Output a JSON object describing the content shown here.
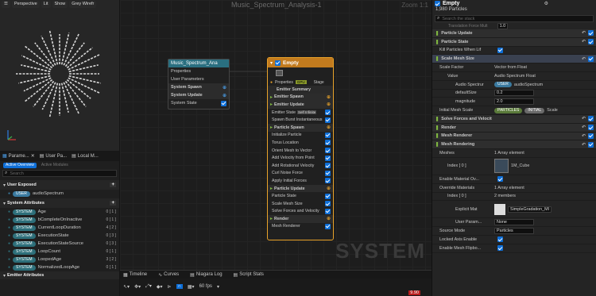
{
  "viewport": {
    "buttons": [
      "Perspective",
      "Lit",
      "Show",
      "Grey Wirefr"
    ]
  },
  "left_tabs": [
    "Parame...",
    "User Pa...",
    "Local M..."
  ],
  "left_subtabs": [
    "Active Overview",
    "Active Modules"
  ],
  "left_search_placeholder": "Search",
  "user_exposed": {
    "title": "User Exposed",
    "items": [
      {
        "tag": "USER",
        "name": "audioSpectrum",
        "count": ""
      }
    ]
  },
  "system_attributes": {
    "title": "System Attributes",
    "items": [
      {
        "tag": "SYSTEM",
        "name": "Age",
        "count": "0 [ 1 ]"
      },
      {
        "tag": "SYSTEM",
        "name": "bCompleteOnInactive",
        "count": "0 [ 1 ]"
      },
      {
        "tag": "SYSTEM",
        "name": "CurrentLoopDuration",
        "count": "4 [ 2 ]"
      },
      {
        "tag": "SYSTEM",
        "name": "ExecutionState",
        "count": "0 [ 3 ]"
      },
      {
        "tag": "SYSTEM",
        "name": "ExecutionStateSource",
        "count": "0 [ 3 ]"
      },
      {
        "tag": "SYSTEM",
        "name": "LoopCount",
        "count": "0 [ 1 ]"
      },
      {
        "tag": "SYSTEM",
        "name": "LoopedAge",
        "count": "3 [ 2 ]"
      },
      {
        "tag": "SYSTEM",
        "name": "NormalizedLoopAge",
        "count": "0 [ 1 ]"
      }
    ]
  },
  "emitter_attributes_title": "Emitter Attributes",
  "graph": {
    "title": "Music_Spectrum_Analysis-1",
    "zoom": "Zoom 1:1",
    "watermark": "SYSTEM",
    "system_node": {
      "title": "Music_Spectrum_Ana",
      "rows": [
        "Properties",
        "User Parameters",
        "System Spawn",
        "System Update",
        "System State"
      ]
    },
    "emitter_node": {
      "title": "Empty",
      "props": [
        "Properties",
        "GPU",
        "Stage"
      ],
      "rows": [
        {
          "label": "Emitter Summary",
          "kind": "header"
        },
        {
          "label": "Emitter Spawn",
          "kind": "section"
        },
        {
          "label": "Emitter Update",
          "kind": "section"
        },
        {
          "label": "Emitter State",
          "kind": "item",
          "extra": "Self  Infinite"
        },
        {
          "label": "Spawn Burst Instantaneous",
          "kind": "item"
        },
        {
          "label": "Particle Spawn",
          "kind": "section"
        },
        {
          "label": "Initialize Particle",
          "kind": "item"
        },
        {
          "label": "Torus Location",
          "kind": "item"
        },
        {
          "label": "Orient Mesh to Vector",
          "kind": "item"
        },
        {
          "label": "Add Velocity from Point",
          "kind": "item"
        },
        {
          "label": "Add Rotational Velocity",
          "kind": "item"
        },
        {
          "label": "Curl Noise Force",
          "kind": "item"
        },
        {
          "label": "Apply Initial Forces",
          "kind": "item"
        },
        {
          "label": "Particle Update",
          "kind": "section"
        },
        {
          "label": "Particle State",
          "kind": "item"
        },
        {
          "label": "Scale Mesh Size",
          "kind": "item"
        },
        {
          "label": "Solve Forces and Velocity",
          "kind": "item"
        },
        {
          "label": "Render",
          "kind": "section"
        },
        {
          "label": "Mesh Renderer",
          "kind": "item"
        }
      ]
    }
  },
  "bottom_tabs": [
    "Timeline",
    "Curves",
    "Niagara Log",
    "Script Stats"
  ],
  "bottom_fps": "60 fps",
  "bottom_frame": "9.90",
  "details": {
    "title": "Empty",
    "subtitle": "1,980 Particles",
    "search_placeholder": "Search the stack",
    "top_cut_label": "Translation Force Mult",
    "top_cut_value": "1.0",
    "rows": [
      {
        "label": "Particle Update"
      },
      {
        "label": "Particle State"
      },
      {
        "label": "Kill Particles When Lif"
      },
      {
        "label": "Scale Mesh Size"
      },
      {
        "label": "Scale Factor",
        "value": "Vector from Float"
      },
      {
        "label": "Value",
        "value": "Audio Spectrum Float"
      },
      {
        "label": "Audio Spectrur",
        "value": "audioSpectrum",
        "tag": "USER"
      },
      {
        "label": "defaultSize",
        "value": "0.2"
      },
      {
        "label": "magnitude",
        "value": "2.0"
      },
      {
        "label": "Initial Mesh Scale",
        "value": "Scale",
        "tag": "PARTICLES",
        "tag2": "INITIAL"
      },
      {
        "label": "Solve Forces and Velocity"
      },
      {
        "label": "Render"
      },
      {
        "label": "Mesh Renderer"
      },
      {
        "label": "Mesh Rendering"
      },
      {
        "label": "Meshes",
        "value": "1 Array element"
      },
      {
        "label": "Index [ 0 ]",
        "value": "1M_Cube"
      },
      {
        "label": "Enable Material Ov..."
      },
      {
        "label": "Override Materials",
        "value": "1 Array element"
      },
      {
        "label": "Index [ 0 ]",
        "value": "2 members"
      },
      {
        "label": "Explicit Mat",
        "value": "SimpleGradation_MI"
      },
      {
        "label": "User Param...",
        "value": "None"
      },
      {
        "label": "Source Mode",
        "value": "Particles"
      },
      {
        "label": "Locked Axis Enable"
      },
      {
        "label": "Enable Mesh Flipbo..."
      }
    ]
  },
  "colors": {
    "accent": "#0e6fd8",
    "system_tag": "#2d6f7a",
    "user_tag": "#3a7aa0",
    "emitter_border": "#e8a22a",
    "section_green": "#7fb640"
  }
}
